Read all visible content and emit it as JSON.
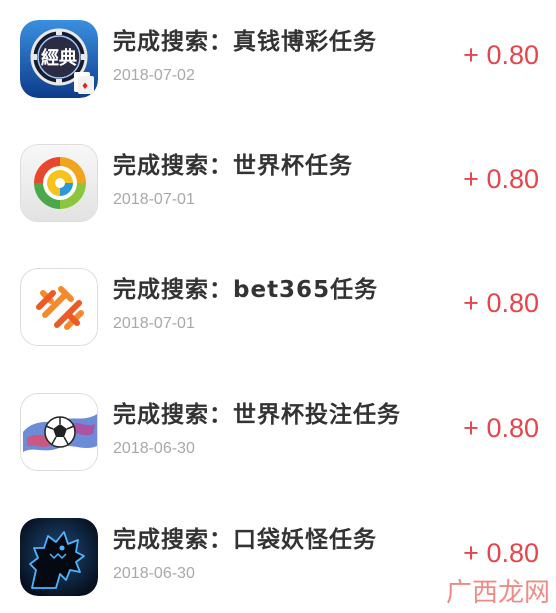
{
  "colors": {
    "amount": "#e5454b",
    "title": "#333333",
    "date": "#a8a8a8"
  },
  "tasks": [
    {
      "icon": "poker-chip-app-icon",
      "icon_text": "經典",
      "title": "完成搜索：真钱博彩任务",
      "date": "2018-07-02",
      "amount": "+ 0.80"
    },
    {
      "icon": "color-wheel-app-icon",
      "title": "完成搜索：世界杯任务",
      "date": "2018-07-01",
      "amount": "+ 0.80"
    },
    {
      "icon": "bet365-logo-app-icon",
      "title": "完成搜索：bet365任务",
      "date": "2018-07-01",
      "amount": "+ 0.80"
    },
    {
      "icon": "soccer-ball-app-icon",
      "title": "完成搜索：世界杯投注任务",
      "date": "2018-06-30",
      "amount": "+ 0.80"
    },
    {
      "icon": "monster-silhouette-app-icon",
      "title": "完成搜索：口袋妖怪任务",
      "date": "2018-06-30",
      "amount": "+ 0.80"
    }
  ],
  "watermark": "广西龙网"
}
